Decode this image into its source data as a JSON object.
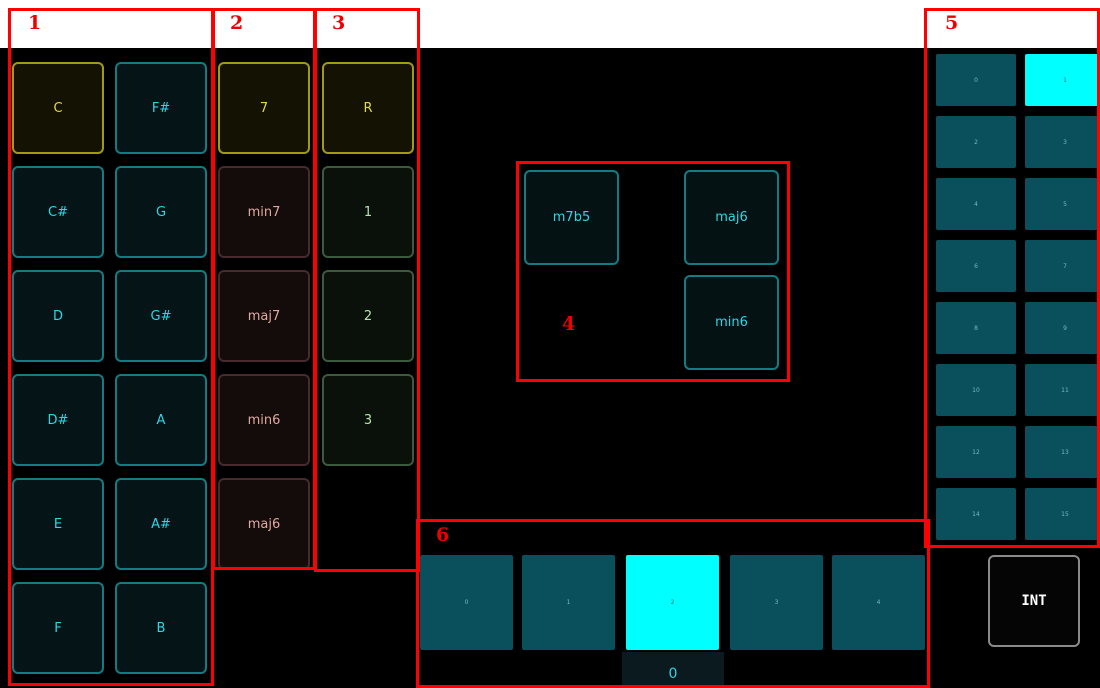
{
  "section_labels": [
    "1",
    "2",
    "3",
    "4",
    "5",
    "6"
  ],
  "root_notes": [
    [
      "C",
      "F#"
    ],
    [
      "C#",
      "G"
    ],
    [
      "D",
      "G#"
    ],
    [
      "D#",
      "A"
    ],
    [
      "E",
      "A#"
    ],
    [
      "F",
      "B"
    ]
  ],
  "qualities": [
    "7",
    "min7",
    "maj7",
    "min6",
    "maj6"
  ],
  "inversions": [
    "R",
    "1",
    "2",
    "3"
  ],
  "favorites": [
    "m7b5",
    "maj6",
    "min6"
  ],
  "banks": [
    [
      "0",
      "1"
    ],
    [
      "2",
      "3"
    ],
    [
      "4",
      "5"
    ],
    [
      "6",
      "7"
    ],
    [
      "8",
      "9"
    ],
    [
      "10",
      "11"
    ],
    [
      "12",
      "13"
    ],
    [
      "14",
      "15"
    ]
  ],
  "selected_bank": "1",
  "sequence_steps": [
    "0",
    "1",
    "2",
    "3",
    "4"
  ],
  "selected_step": "2",
  "sequence_value": "0",
  "int_label": "INT",
  "colors": {
    "accent_cyan": "#00ffff",
    "note_teal": "#147b83",
    "selected_yellow": "#a39a14",
    "quality_red": "#4a2a2a",
    "inversion_green": "#3c5a3c",
    "bank_blue": "#0a4f5c",
    "annotation_red": "#ff0000"
  }
}
